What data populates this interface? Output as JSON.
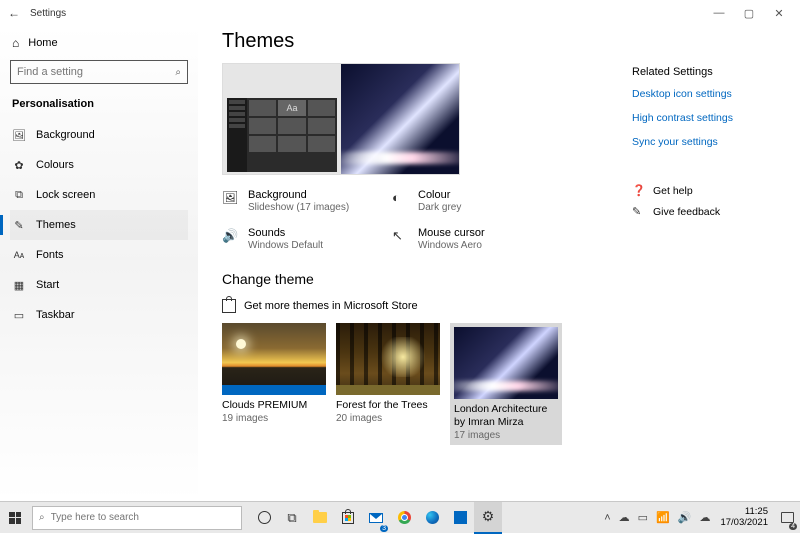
{
  "window": {
    "title": "Settings"
  },
  "sidebar": {
    "home": "Home",
    "search_placeholder": "Find a setting",
    "section": "Personalisation",
    "items": [
      {
        "label": "Background"
      },
      {
        "label": "Colours"
      },
      {
        "label": "Lock screen"
      },
      {
        "label": "Themes"
      },
      {
        "label": "Fonts"
      },
      {
        "label": "Start"
      },
      {
        "label": "Taskbar"
      }
    ]
  },
  "page": {
    "title": "Themes",
    "options": {
      "background": {
        "label": "Background",
        "value": "Slideshow (17 images)"
      },
      "colour": {
        "label": "Colour",
        "value": "Dark grey"
      },
      "sounds": {
        "label": "Sounds",
        "value": "Windows Default"
      },
      "cursor": {
        "label": "Mouse cursor",
        "value": "Windows Aero"
      }
    },
    "change_theme": "Change theme",
    "store_link": "Get more themes in Microsoft Store",
    "themes": [
      {
        "name": "Clouds PREMIUM",
        "count": "19 images",
        "accent": "#0067c0"
      },
      {
        "name": "Forest for the Trees",
        "count": "20 images",
        "accent": "#7a6a2e"
      },
      {
        "name": "London Architecture by Imran Mirza",
        "count": "17 images",
        "accent": ""
      }
    ]
  },
  "related": {
    "heading": "Related Settings",
    "links": [
      "Desktop icon settings",
      "High contrast settings",
      "Sync your settings"
    ],
    "help": "Get help",
    "feedback": "Give feedback"
  },
  "taskbar": {
    "search_placeholder": "Type here to search",
    "mail_badge": "3",
    "time": "11:25",
    "date": "17/03/2021",
    "notif_badge": "4"
  }
}
